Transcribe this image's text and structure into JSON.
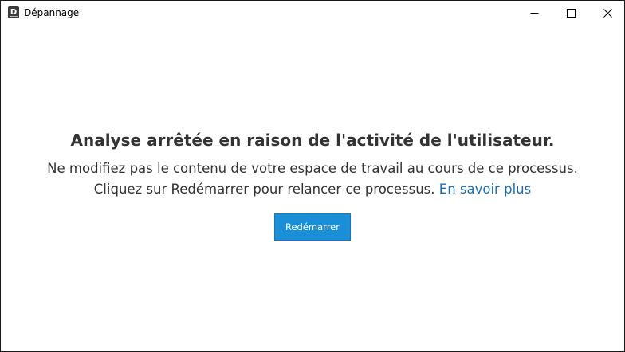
{
  "window": {
    "title": "Dépannage",
    "icon_letter": "D",
    "controls": {
      "minimize": "minimize-icon",
      "maximize": "maximize-icon",
      "close": "close-icon"
    }
  },
  "message": {
    "headline": "Analyse arrêtée en raison de l'activité de l'utilisateur.",
    "line1": "Ne modifiez pas le contenu de votre espace de travail au cours de ce processus.",
    "line2": "Cliquez sur Redémarrer pour relancer ce processus.",
    "link": "En savoir plus"
  },
  "actions": {
    "restart_label": "Redémarrer"
  },
  "colors": {
    "accent": "#1a8ed6",
    "link": "#1e6fb0",
    "text": "#333333"
  }
}
